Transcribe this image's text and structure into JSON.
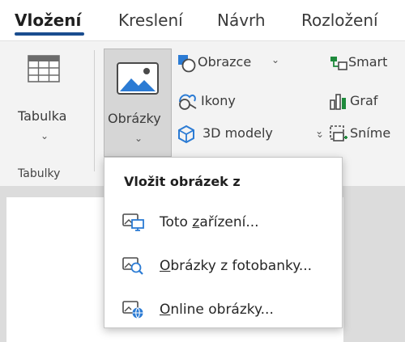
{
  "tabs": [
    {
      "label": "Vložení",
      "active": true
    },
    {
      "label": "Kreslení",
      "active": false
    },
    {
      "label": "Návrh",
      "active": false
    },
    {
      "label": "Rozložení",
      "active": false
    }
  ],
  "ribbon": {
    "table": {
      "label": "Tabulka",
      "group_label": "Tabulky"
    },
    "pictures": {
      "label": "Obrázky"
    },
    "shapes": {
      "label": "Obrazce"
    },
    "icons": {
      "label": "Ikony"
    },
    "models3d": {
      "label": "3D modely"
    },
    "smartart": {
      "label": "Smart"
    },
    "chart": {
      "label": "Graf"
    },
    "screenshot": {
      "label": "Sníme"
    }
  },
  "menu": {
    "title": "Vložit obrázek z",
    "items": [
      {
        "label_first": "Toto ",
        "label_underlined": "z",
        "label_rest": "ařízení...",
        "icon": "device-picture-icon"
      },
      {
        "label_first": "",
        "label_underlined": "O",
        "label_rest": "brázky z fotobanky...",
        "icon": "stock-images-icon"
      },
      {
        "label_first": "",
        "label_underlined": "O",
        "label_rest": "nline obrázky...",
        "icon": "online-pictures-icon"
      }
    ]
  },
  "colors": {
    "accent_underline": "#1a4d8f",
    "icon_blue": "#2b7bd4",
    "chart_green": "#1e8a3c"
  }
}
